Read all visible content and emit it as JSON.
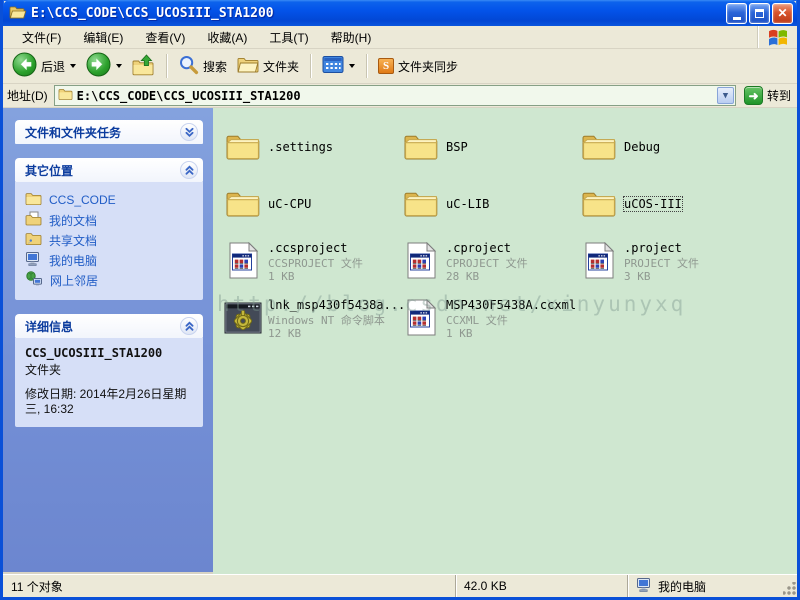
{
  "window": {
    "title": "E:\\CCS_CODE\\CCS_UCOSIII_STA1200"
  },
  "menu": {
    "items": [
      "文件(F)",
      "编辑(E)",
      "查看(V)",
      "收藏(A)",
      "工具(T)",
      "帮助(H)"
    ]
  },
  "toolbar": {
    "back_label": "后退",
    "search_label": "搜索",
    "folders_label": "文件夹",
    "sync_label": "文件夹同步",
    "sync_icon_letter": "S"
  },
  "address": {
    "label": "地址(D)",
    "value": "E:\\CCS_CODE\\CCS_UCOSIII_STA1200",
    "go_label": "转到"
  },
  "sidebar": {
    "tasks_header": "文件和文件夹任务",
    "places_header": "其它位置",
    "places": [
      {
        "id": "ccs-code",
        "label": "CCS_CODE",
        "icon": "folder16"
      },
      {
        "id": "my-documents",
        "label": "我的文档",
        "icon": "documents16"
      },
      {
        "id": "shared-documents",
        "label": "共享文档",
        "icon": "sharedfolder16"
      },
      {
        "id": "my-computer",
        "label": "我的电脑",
        "icon": "computer16"
      },
      {
        "id": "network-places",
        "label": "网上邻居",
        "icon": "network16"
      }
    ],
    "details_header": "详细信息",
    "details": {
      "name": "CCS_UCOSIII_STA1200",
      "type": "文件夹",
      "modified": "修改日期: 2014年2月26日星期三, 16:32"
    }
  },
  "files": {
    "watermark": "http://blog.csdn.net/xinyunyxq",
    "items": [
      {
        "id": "settings-folder",
        "name": ".settings",
        "kind": "folder32"
      },
      {
        "id": "bsp-folder",
        "name": "BSP",
        "kind": "folder32"
      },
      {
        "id": "debug-folder",
        "name": "Debug",
        "kind": "folder32"
      },
      {
        "id": "uc-cpu-folder",
        "name": "uC-CPU",
        "kind": "folder32"
      },
      {
        "id": "uc-lib-folder",
        "name": "uC-LIB",
        "kind": "folder32"
      },
      {
        "id": "ucos-iii-folder",
        "name": "uCOS-III",
        "kind": "folder32",
        "focused": true
      },
      {
        "id": "ccsproject-file",
        "name": ".ccsproject",
        "kind": "doc32",
        "type": "CCSPROJECT 文件",
        "size": "1 KB"
      },
      {
        "id": "cproject-file",
        "name": ".cproject",
        "kind": "doc32",
        "type": "CPROJECT 文件",
        "size": "28 KB"
      },
      {
        "id": "project-file",
        "name": ".project",
        "kind": "doc32",
        "type": "PROJECT 文件",
        "size": "3 KB"
      },
      {
        "id": "lnk-script-file",
        "name": "lnk_msp430f5438a...",
        "kind": "script32",
        "type": "Windows NT 命令脚本",
        "size": "12 KB"
      },
      {
        "id": "ccxml-file",
        "name": "MSP430F5438A.ccxml",
        "kind": "doc32",
        "type": "CCXML 文件",
        "size": "1 KB"
      }
    ]
  },
  "statusbar": {
    "objects": "11 个对象",
    "size": "42.0 KB",
    "zone": "我的电脑"
  }
}
